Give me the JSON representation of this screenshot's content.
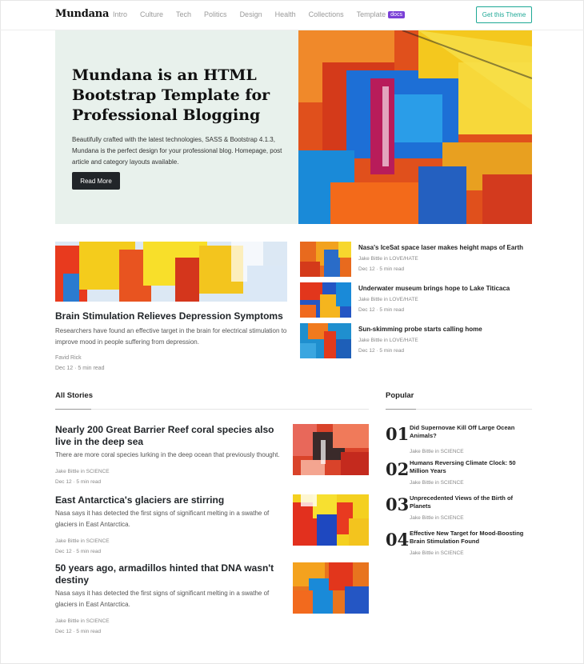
{
  "brand": "Mundana",
  "nav": {
    "links": [
      "Intro",
      "Culture",
      "Tech",
      "Politics",
      "Design",
      "Health",
      "Collections",
      "Template"
    ],
    "badge": "docs",
    "cta": "Get this Theme"
  },
  "hero": {
    "title": "Mundana is an HTML Bootstrap Template for Professional Blogging",
    "description": "Beautifully crafted with the latest technologies, SASS & Bootstrap 4.1.3, Mundana is the perfect design for your professional blog. Homepage, post article and category layouts available.",
    "button": "Read More"
  },
  "featured": {
    "title": "Brain Stimulation Relieves Depression Symptoms",
    "description": "Researchers have found an effective target in the brain for electrical stimulation to improve mood in people suffering from depression.",
    "author": "Favid Rick",
    "date": "Dec 12 · 5 min read"
  },
  "side_items": [
    {
      "title": "Nasa's IceSat space laser makes height maps of Earth",
      "author": "Jake Bittle in LOVE/HATE",
      "date": "Dec 12 · 5 min read"
    },
    {
      "title": "Underwater museum brings hope to Lake Titicaca",
      "author": "Jake Bittle in LOVE/HATE",
      "date": "Dec 12 · 5 min read"
    },
    {
      "title": "Sun-skimming probe starts calling home",
      "author": "Jake Bittle in LOVE/HATE",
      "date": "Dec 12 · 5 min read"
    }
  ],
  "all_stories": {
    "heading": "All Stories",
    "items": [
      {
        "title": "Nearly 200 Great Barrier Reef coral species also live in the deep sea",
        "description": "There are more coral species lurking in the deep ocean that previously thought.",
        "author": "Jake Bittle in SCIENCE",
        "date": "Dec 12 · 5 min read"
      },
      {
        "title": "East Antarctica's glaciers are stirring",
        "description": "Nasa says it has detected the first signs of significant melting in a swathe of glaciers in East Antarctica.",
        "author": "Jake Bittle in SCIENCE",
        "date": "Dec 12 · 5 min read"
      },
      {
        "title": "50 years ago, armadillos hinted that DNA wasn't destiny",
        "description": "Nasa says it has detected the first signs of significant melting in a swathe of glaciers in East Antarctica.",
        "author": "Jake Bittle in SCIENCE",
        "date": "Dec 12 · 5 min read"
      }
    ]
  },
  "popular": {
    "heading": "Popular",
    "items": [
      {
        "num": "01",
        "title": "Did Supernovae Kill Off Large Ocean Animals?",
        "author": "Jake Bittle in SCIENCE"
      },
      {
        "num": "02",
        "title": "Humans Reversing Climate Clock: 50 Million Years",
        "author": "Jake Bittle in SCIENCE"
      },
      {
        "num": "03",
        "title": "Unprecedented Views of the Birth of Planets",
        "author": "Jake Bittle in SCIENCE"
      },
      {
        "num": "04",
        "title": "Effective New Target for Mood-Boosting Brain Stimulation Found",
        "author": "Jake Bittle in SCIENCE"
      }
    ]
  },
  "colors": {
    "accent": "#1ea896",
    "badge": "#7a3fd6",
    "hero_bg": "#e8f1ec",
    "button": "#212529"
  }
}
